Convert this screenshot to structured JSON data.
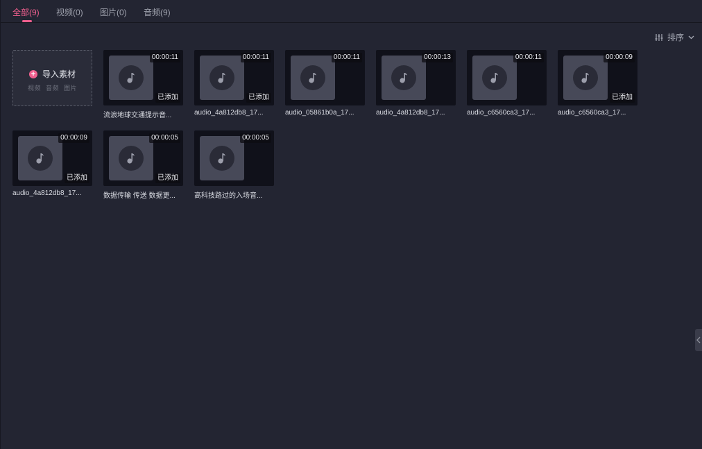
{
  "tabs": [
    {
      "label": "全部(9)",
      "active": true
    },
    {
      "label": "视频(0)",
      "active": false
    },
    {
      "label": "图片(0)",
      "active": false
    },
    {
      "label": "音频(9)",
      "active": false
    }
  ],
  "sort": {
    "label": "排序",
    "icon": "sliders-icon"
  },
  "import": {
    "title": "导入素材",
    "types": [
      "视频",
      "音频",
      "图片"
    ]
  },
  "items": [
    {
      "name": "流浪地球交通提示音...",
      "duration": "00:00:11",
      "added_label": "已添加",
      "added": true
    },
    {
      "name": "audio_4a812db8_17...",
      "duration": "00:00:11",
      "added_label": "已添加",
      "added": true
    },
    {
      "name": "audio_05861b0a_17...",
      "duration": "00:00:11",
      "added_label": "",
      "added": false
    },
    {
      "name": "audio_4a812db8_17...",
      "duration": "00:00:13",
      "added_label": "",
      "added": false
    },
    {
      "name": "audio_c6560ca3_17...",
      "duration": "00:00:11",
      "added_label": "",
      "added": false
    },
    {
      "name": "audio_c6560ca3_17...",
      "duration": "00:00:09",
      "added_label": "已添加",
      "added": true
    },
    {
      "name": "audio_4a812db8_17...",
      "duration": "00:00:09",
      "added_label": "已添加",
      "added": true
    },
    {
      "name": "数据传输 传送 数据更...",
      "duration": "00:00:05",
      "added_label": "已添加",
      "added": true
    },
    {
      "name": "高科技路过的入场音...",
      "duration": "00:00:05",
      "added_label": "",
      "added": false
    }
  ],
  "colors": {
    "accent": "#f0608f",
    "background": "#232532",
    "card": "#10111a",
    "cover": "#474958"
  }
}
